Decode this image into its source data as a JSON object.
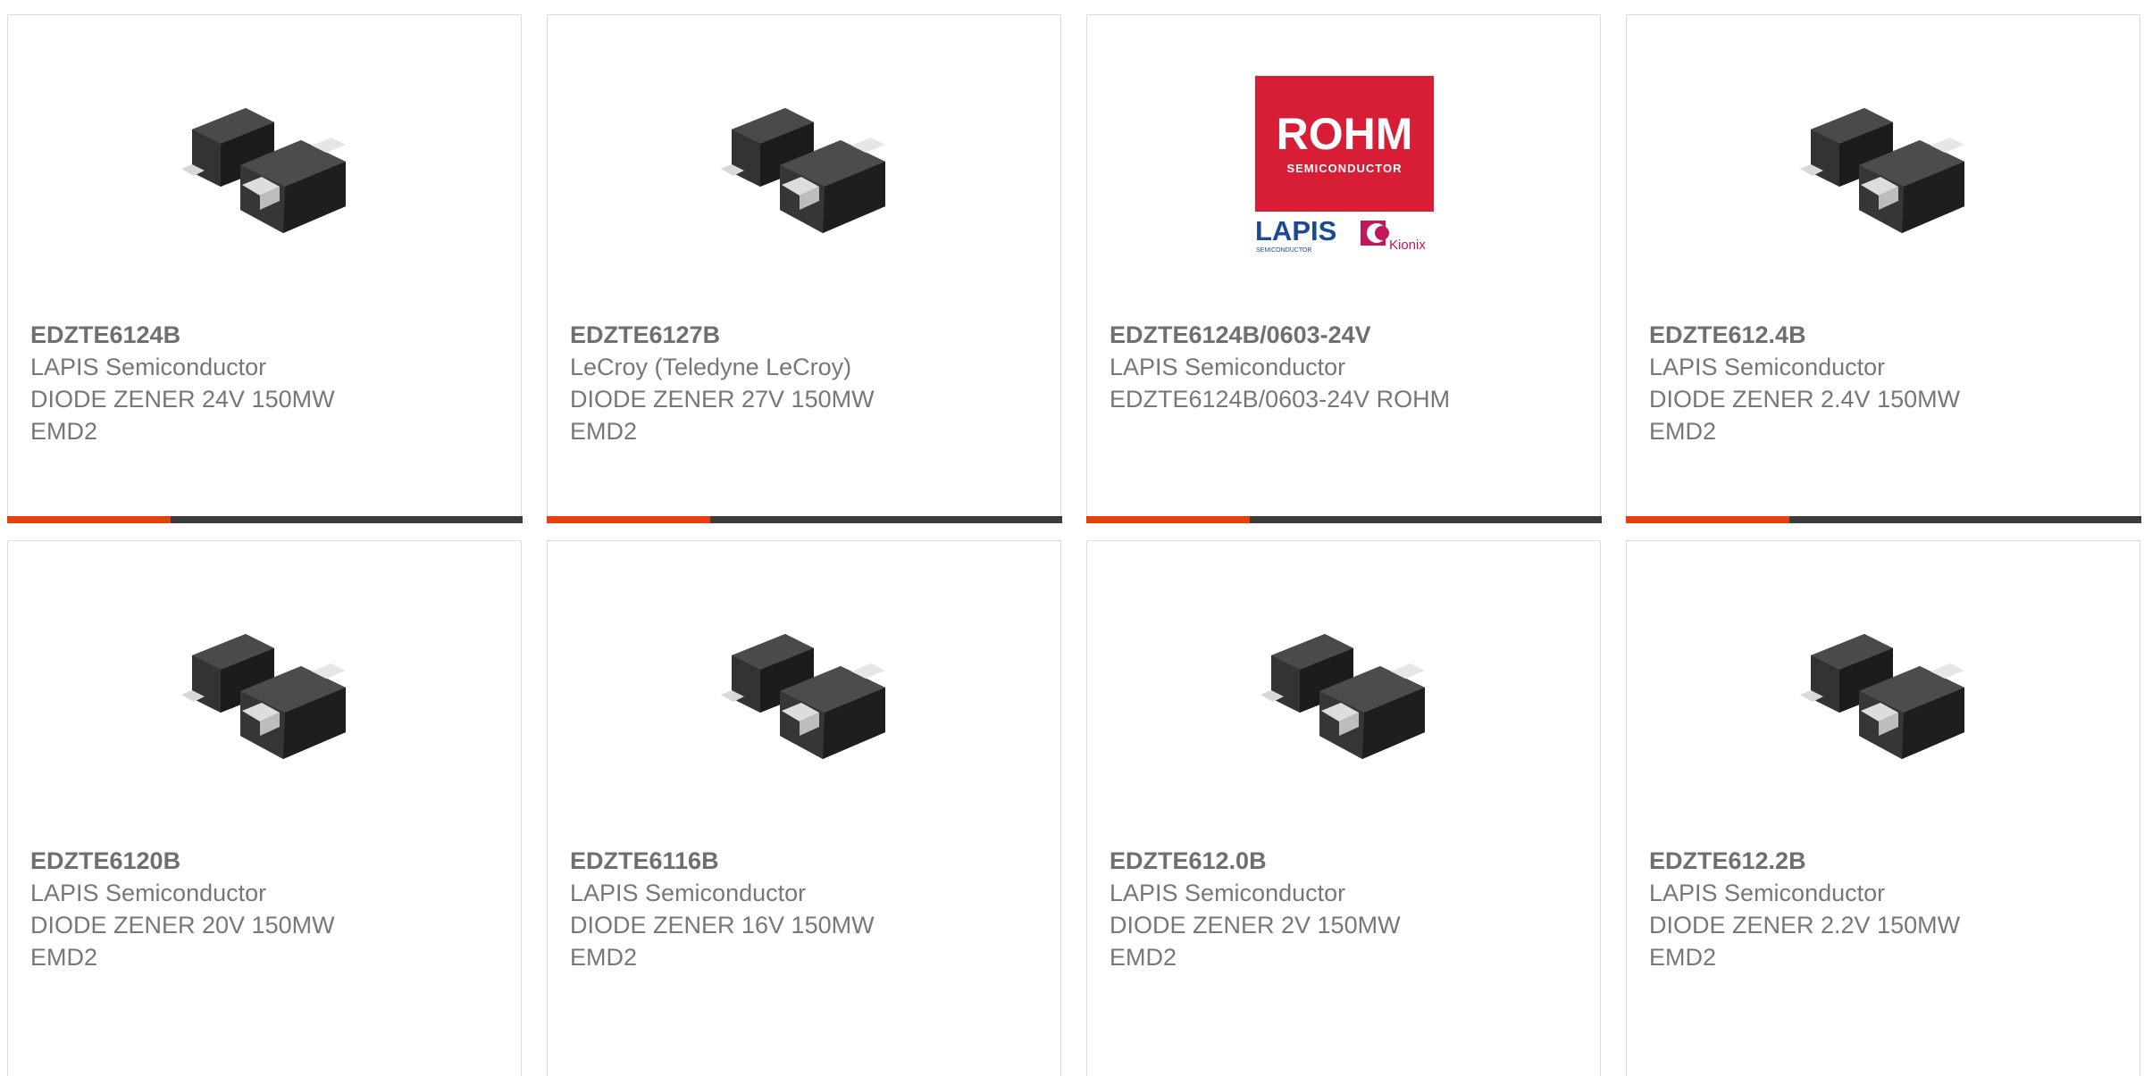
{
  "theme": {
    "accent": "#e8400c",
    "bar_dark": "#3c3c3c",
    "logo_red": "#d71e36",
    "lapis_blue": "#1a4a96",
    "kionix_magenta": "#c2185b"
  },
  "products": [
    {
      "part": "EDZTE6124B",
      "maker": "LAPIS Semiconductor",
      "desc": "DIODE ZENER 24V 150MW",
      "pkg": "EMD2",
      "image": "diode-package-icon"
    },
    {
      "part": "EDZTE6127B",
      "maker": "LeCroy (Teledyne LeCroy)",
      "desc": "DIODE ZENER 27V 150MW",
      "pkg": "EMD2",
      "image": "diode-package-icon"
    },
    {
      "part": "EDZTE6124B/0603-24V",
      "maker": "LAPIS Semiconductor",
      "desc": "EDZTE6124B/0603-24V ROHM",
      "pkg": "",
      "image": "rohm-logo",
      "logo": {
        "brand": "ROHM",
        "tagline": "SEMICONDUCTOR",
        "sub_brand": "LAPIS",
        "sub_tagline": "SEMICONDUCTOR",
        "kionix": "Kionix"
      }
    },
    {
      "part": "EDZTE612.4B",
      "maker": "LAPIS Semiconductor",
      "desc": "DIODE ZENER 2.4V 150MW",
      "pkg": "EMD2",
      "image": "diode-package-icon"
    },
    {
      "part": "EDZTE6120B",
      "maker": "LAPIS Semiconductor",
      "desc": "DIODE ZENER 20V 150MW",
      "pkg": "EMD2",
      "image": "diode-package-icon"
    },
    {
      "part": "EDZTE6116B",
      "maker": "LAPIS Semiconductor",
      "desc": "DIODE ZENER 16V 150MW",
      "pkg": "EMD2",
      "image": "diode-package-icon"
    },
    {
      "part": "EDZTE612.0B",
      "maker": "LAPIS Semiconductor",
      "desc": "DIODE ZENER 2V 150MW",
      "pkg": "EMD2",
      "image": "diode-package-icon"
    },
    {
      "part": "EDZTE612.2B",
      "maker": "LAPIS Semiconductor",
      "desc": "DIODE ZENER 2.2V 150MW",
      "pkg": "EMD2",
      "image": "diode-package-icon"
    }
  ]
}
